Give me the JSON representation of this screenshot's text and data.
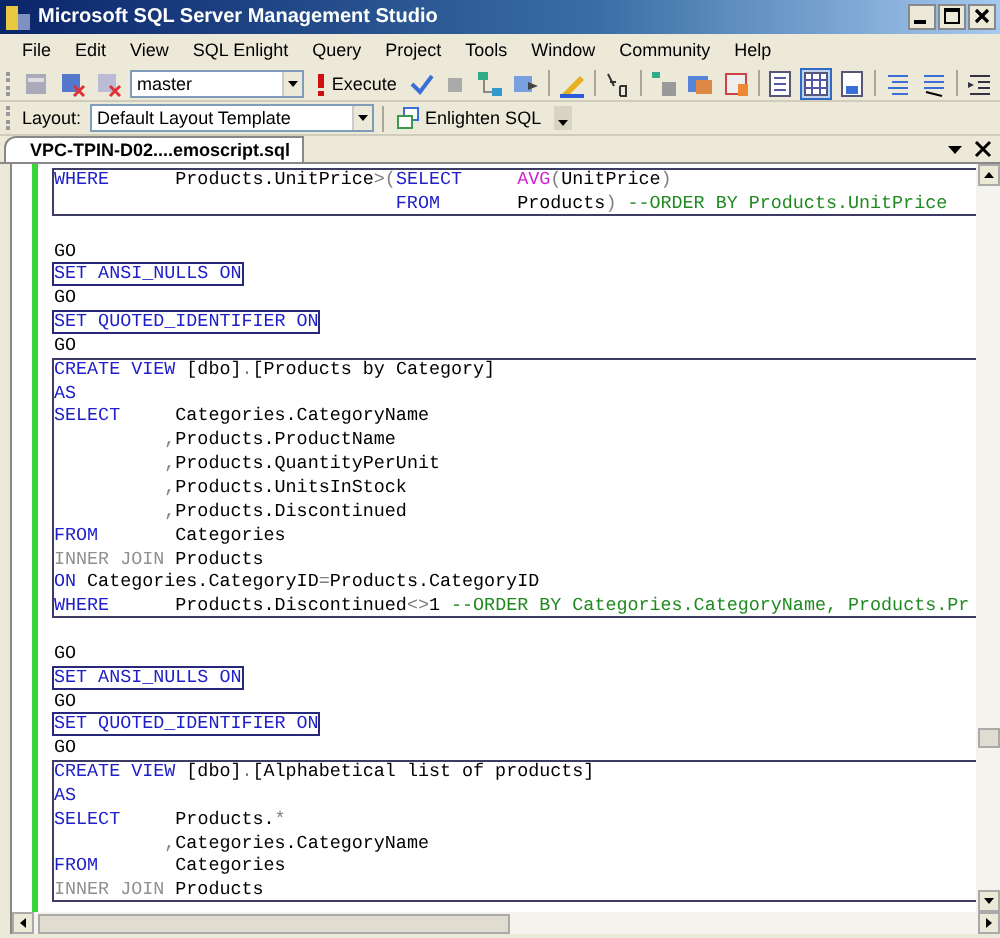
{
  "window": {
    "title": "Microsoft SQL Server Management Studio"
  },
  "menu": [
    "File",
    "Edit",
    "View",
    "SQL Enlight",
    "Query",
    "Project",
    "Tools",
    "Window",
    "Community",
    "Help"
  ],
  "toolbar": {
    "database": "master",
    "execute": "Execute"
  },
  "layout_toolbar": {
    "label": "Layout:",
    "template": "Default Layout Template",
    "button": "Enlighten SQL"
  },
  "tabs": [
    {
      "label": "VPC-TPIN-D02....emoscript.sql",
      "selected": true
    }
  ],
  "editor": {
    "blocks": [
      {
        "kind": "statement",
        "lines": [
          [
            {
              "kind": "keyword",
              "text": "WHERE"
            },
            {
              "kind": "plain",
              "text": "      Products.UnitPrice"
            },
            {
              "kind": "operator",
              "text": ">("
            },
            {
              "kind": "keyword",
              "text": "SELECT     "
            },
            {
              "kind": "function",
              "text": "AVG"
            },
            {
              "kind": "operator",
              "text": "("
            },
            {
              "kind": "plain",
              "text": "UnitPrice"
            },
            {
              "kind": "operator",
              "text": ")"
            }
          ],
          [
            {
              "kind": "keyword",
              "text": "                               FROM"
            },
            {
              "kind": "plain",
              "text": "       Products"
            },
            {
              "kind": "operator",
              "text": ") "
            },
            {
              "kind": "comment",
              "text": "--ORDER BY Products.UnitPrice"
            }
          ]
        ]
      },
      {
        "kind": "batch",
        "lines": [
          [
            {
              "kind": "plain",
              "text": "GO"
            }
          ]
        ]
      },
      {
        "kind": "setting",
        "lines": [
          [
            {
              "kind": "keyword",
              "text": "SET ANSI_NULLS ON"
            }
          ]
        ]
      },
      {
        "kind": "batch",
        "lines": [
          [
            {
              "kind": "plain",
              "text": "GO"
            }
          ]
        ]
      },
      {
        "kind": "setting",
        "lines": [
          [
            {
              "kind": "keyword",
              "text": "SET QUOTED_IDENTIFIER ON"
            }
          ]
        ]
      },
      {
        "kind": "batch",
        "lines": [
          [
            {
              "kind": "plain",
              "text": "GO"
            }
          ]
        ]
      },
      {
        "kind": "statement",
        "lines": [
          [
            {
              "kind": "keyword",
              "text": "CREATE VIEW"
            },
            {
              "kind": "plain",
              "text": " [dbo]"
            },
            {
              "kind": "operator",
              "text": "."
            },
            {
              "kind": "plain",
              "text": "[Products by Category]"
            }
          ],
          [
            {
              "kind": "keyword",
              "text": "AS"
            }
          ],
          [
            {
              "kind": "keyword",
              "text": "SELECT"
            },
            {
              "kind": "plain",
              "text": "     Categories.CategoryName"
            }
          ],
          [
            {
              "kind": "operator",
              "text": "          ,"
            },
            {
              "kind": "plain",
              "text": "Products.ProductName"
            }
          ],
          [
            {
              "kind": "operator",
              "text": "          ,"
            },
            {
              "kind": "plain",
              "text": "Products.QuantityPerUnit"
            }
          ],
          [
            {
              "kind": "operator",
              "text": "          ,"
            },
            {
              "kind": "plain",
              "text": "Products.UnitsInStock"
            }
          ],
          [
            {
              "kind": "operator",
              "text": "          ,"
            },
            {
              "kind": "plain",
              "text": "Products.Discontinued"
            }
          ],
          [
            {
              "kind": "keyword",
              "text": "FROM"
            },
            {
              "kind": "plain",
              "text": "       Categories"
            }
          ],
          [
            {
              "kind": "join",
              "text": "INNER JOIN"
            },
            {
              "kind": "plain",
              "text": " Products"
            }
          ],
          [
            {
              "kind": "keyword",
              "text": "ON"
            },
            {
              "kind": "plain",
              "text": " Categories.CategoryID"
            },
            {
              "kind": "operator",
              "text": "="
            },
            {
              "kind": "plain",
              "text": "Products.CategoryID"
            }
          ],
          [
            {
              "kind": "keyword",
              "text": "WHERE"
            },
            {
              "kind": "plain",
              "text": "      Products.Discontinued"
            },
            {
              "kind": "operator",
              "text": "<>"
            },
            {
              "kind": "plain",
              "text": "1 "
            },
            {
              "kind": "comment",
              "text": "--ORDER BY Categories.CategoryName, Products.Pr"
            }
          ]
        ]
      },
      {
        "kind": "batch",
        "lines": [
          [
            {
              "kind": "plain",
              "text": "GO"
            }
          ]
        ]
      },
      {
        "kind": "setting",
        "lines": [
          [
            {
              "kind": "keyword",
              "text": "SET ANSI_NULLS ON"
            }
          ]
        ]
      },
      {
        "kind": "batch",
        "lines": [
          [
            {
              "kind": "plain",
              "text": "GO"
            }
          ]
        ]
      },
      {
        "kind": "setting",
        "lines": [
          [
            {
              "kind": "keyword",
              "text": "SET QUOTED_IDENTIFIER ON"
            }
          ]
        ]
      },
      {
        "kind": "batch",
        "lines": [
          [
            {
              "kind": "plain",
              "text": "GO"
            }
          ]
        ]
      },
      {
        "kind": "statement",
        "lines": [
          [
            {
              "kind": "keyword",
              "text": "CREATE VIEW"
            },
            {
              "kind": "plain",
              "text": " [dbo]"
            },
            {
              "kind": "operator",
              "text": "."
            },
            {
              "kind": "plain",
              "text": "[Alphabetical list of products]"
            }
          ],
          [
            {
              "kind": "keyword",
              "text": "AS"
            }
          ],
          [
            {
              "kind": "keyword",
              "text": "SELECT"
            },
            {
              "kind": "plain",
              "text": "     Products."
            },
            {
              "kind": "operator",
              "text": "*"
            }
          ],
          [
            {
              "kind": "operator",
              "text": "          ,"
            },
            {
              "kind": "plain",
              "text": "Categories.CategoryName"
            }
          ],
          [
            {
              "kind": "keyword",
              "text": "FROM"
            },
            {
              "kind": "plain",
              "text": "       Categories"
            }
          ],
          [
            {
              "kind": "join",
              "text": "INNER JOIN"
            },
            {
              "kind": "plain",
              "text": " Products"
            }
          ]
        ]
      }
    ]
  }
}
